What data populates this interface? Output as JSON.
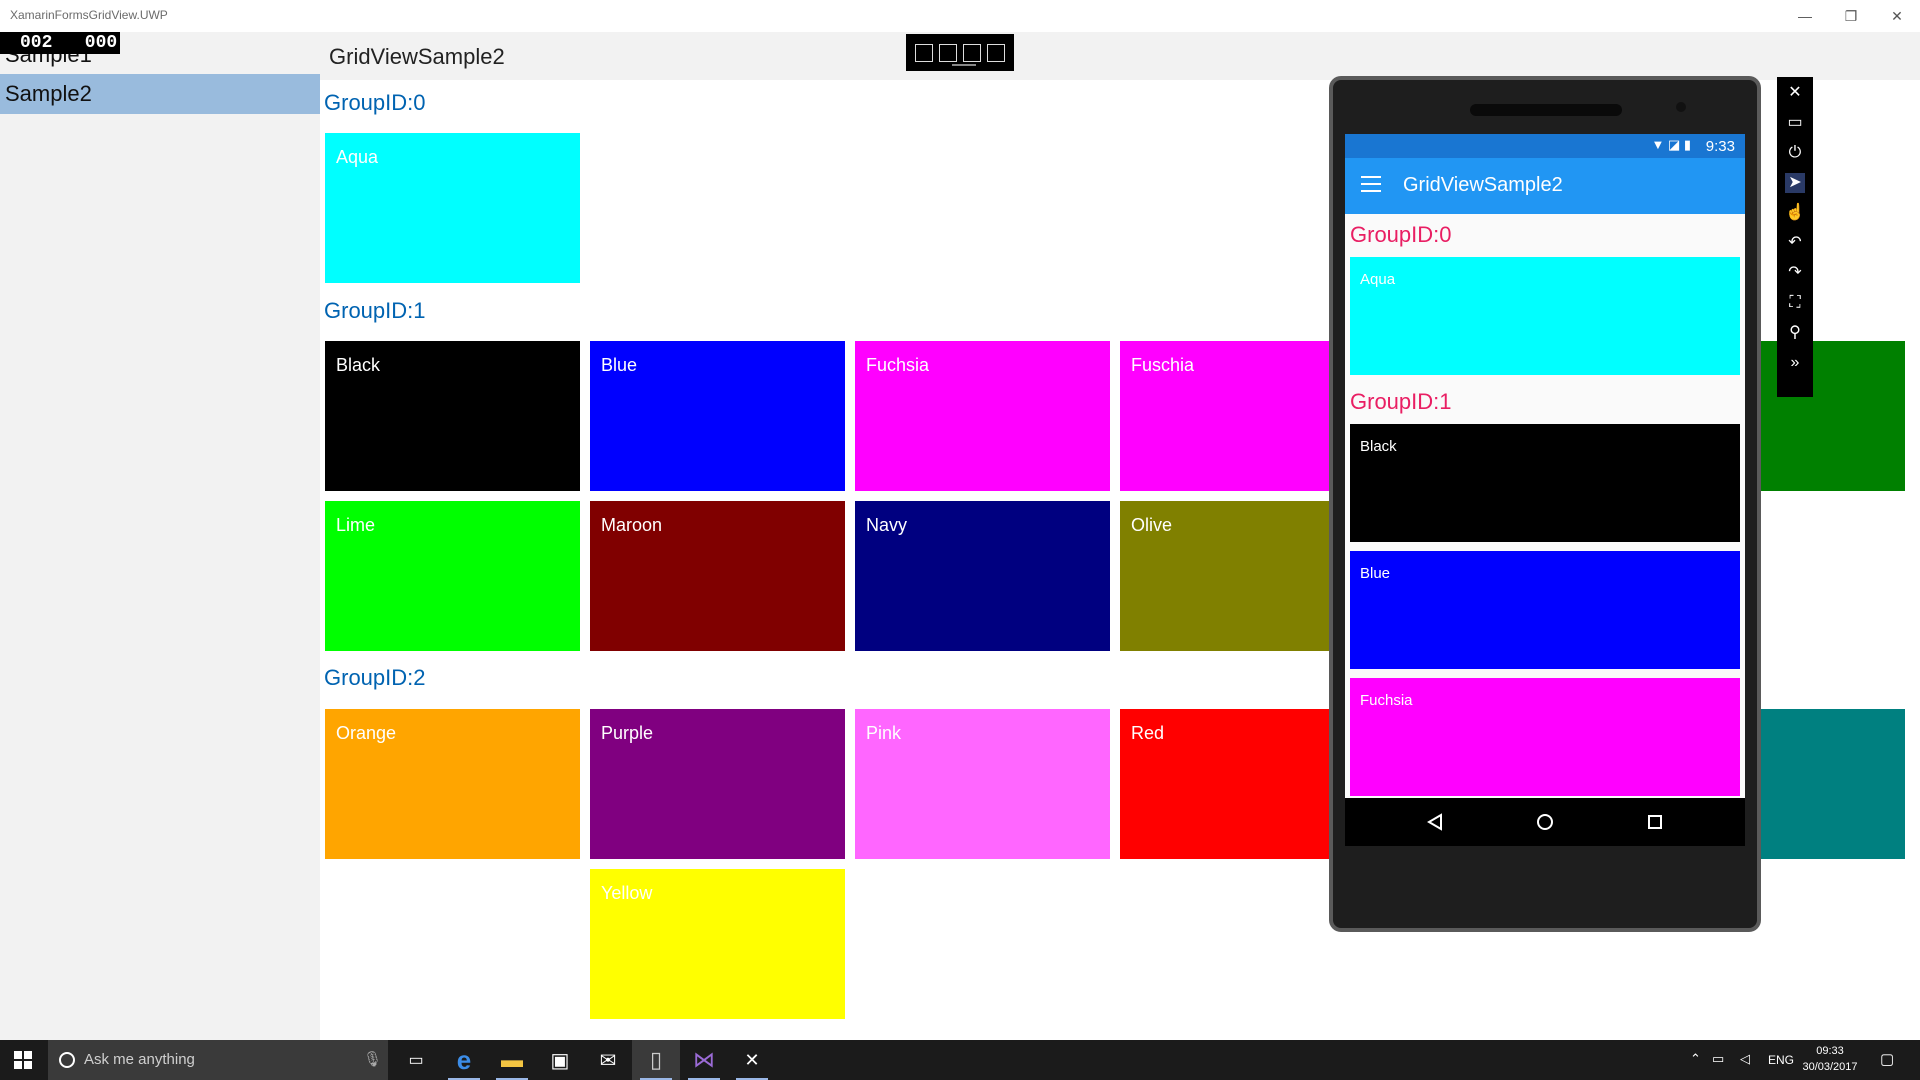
{
  "window": {
    "title": "XamarinFormsGridView.UWP",
    "minimize": "—",
    "maximize": "❐",
    "close": "✕"
  },
  "left_nav": {
    "items": [
      {
        "label": "Sample1"
      },
      {
        "label": "Sample2",
        "selected": true
      }
    ]
  },
  "fps_counter": "002   000",
  "header": {
    "title": "GridViewSample2"
  },
  "groups": [
    {
      "title": "GroupID:0",
      "tiles": [
        {
          "label": "Aqua",
          "color": "#00ffff",
          "text_color": "#ffffff"
        }
      ]
    },
    {
      "title": "GroupID:1",
      "tiles": [
        {
          "label": "Black",
          "color": "#000000",
          "text_color": "#ffffff"
        },
        {
          "label": "Blue",
          "color": "#0000ff",
          "text_color": "#ffffff"
        },
        {
          "label": "Fuchsia",
          "color": "#ff00ff",
          "text_color": "#ffffff"
        },
        {
          "label": "Fuschia",
          "color": "#ff00ff",
          "text_color": "#ffffff"
        },
        {
          "label": "Lime",
          "color": "#00ff00",
          "text_color": "#ffffff"
        },
        {
          "label": "Maroon",
          "color": "#800000",
          "text_color": "#ffffff"
        },
        {
          "label": "Navy",
          "color": "#000080",
          "text_color": "#ffffff"
        },
        {
          "label": "Olive",
          "color": "#808000",
          "text_color": "#ffffff"
        }
      ]
    },
    {
      "title": "GroupID:2",
      "tiles": [
        {
          "label": "Orange",
          "color": "#ffa500",
          "text_color": "#ffffff"
        },
        {
          "label": "Purple",
          "color": "#800080",
          "text_color": "#ffffff"
        },
        {
          "label": "Pink",
          "color": "#ff66ff",
          "text_color": "#ffffff"
        },
        {
          "label": "Red",
          "color": "#ff0000",
          "text_color": "#ffffff"
        },
        {
          "label": "Yellow",
          "color": "#ffff00",
          "text_color": "#ffffff"
        }
      ]
    }
  ],
  "hidden_tiles": [
    {
      "color": "#008000"
    },
    {
      "color": "#008080"
    }
  ],
  "phone": {
    "status_time": "9:33",
    "status_icons": "▼ ◪ ▮",
    "app_title": "GridViewSample2",
    "groups": [
      {
        "title": "GroupID:0",
        "tiles": [
          {
            "label": "Aqua",
            "color": "#00ffff"
          }
        ]
      },
      {
        "title": "GroupID:1",
        "tiles": [
          {
            "label": "Black",
            "color": "#000000"
          },
          {
            "label": "Blue",
            "color": "#0000ff"
          },
          {
            "label": "Fuchsia",
            "color": "#ff00ff"
          }
        ]
      }
    ],
    "nav": {
      "back": "◁",
      "home": "○",
      "recents": "□"
    }
  },
  "emulator_tools": [
    {
      "icon": "close-icon",
      "glyph": "✕"
    },
    {
      "icon": "minimize-icon",
      "glyph": "▭"
    },
    {
      "icon": "power-icon",
      "glyph": "⏻"
    },
    {
      "icon": "pointer-icon",
      "glyph": "➤"
    },
    {
      "icon": "touch-icon",
      "glyph": "☝"
    },
    {
      "icon": "rotate-left-icon",
      "glyph": "↶"
    },
    {
      "icon": "rotate-right-icon",
      "glyph": "↷"
    },
    {
      "icon": "fit-screen-icon",
      "glyph": "⛶"
    },
    {
      "icon": "zoom-icon",
      "glyph": "⚲"
    },
    {
      "icon": "more-tools-icon",
      "glyph": "»"
    }
  ],
  "taskbar": {
    "search_placeholder": "Ask me anything",
    "apps": [
      {
        "icon": "task-view-icon",
        "glyph": "▭",
        "color": "#ffffff"
      },
      {
        "icon": "edge-icon",
        "glyph": "e",
        "color": "#3c8de8"
      },
      {
        "icon": "file-explorer-icon",
        "glyph": "▬",
        "color": "#f4c542"
      },
      {
        "icon": "store-icon",
        "glyph": "▣",
        "color": "#ffffff"
      },
      {
        "icon": "mail-icon",
        "glyph": "✉",
        "color": "#ffffff"
      },
      {
        "icon": "phone-emulator-icon",
        "glyph": "▯",
        "color": "#cccccc"
      },
      {
        "icon": "visual-studio-icon",
        "glyph": "⋈",
        "color": "#9b6bd6"
      },
      {
        "icon": "xamarin-icon",
        "glyph": "✕",
        "color": "#ffffff"
      }
    ],
    "tray_lang": "ENG",
    "clock_time": "09:33",
    "clock_date": "30/03/2017"
  }
}
